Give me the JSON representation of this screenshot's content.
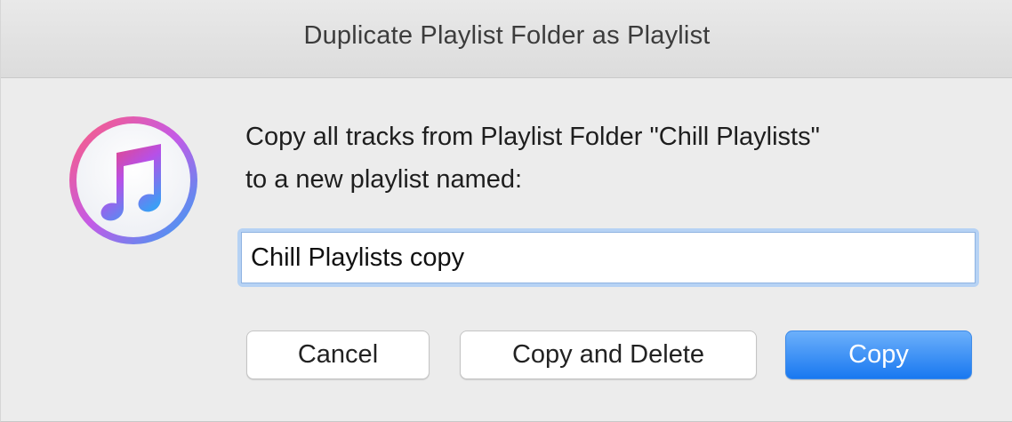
{
  "window": {
    "title": "Duplicate Playlist Folder as Playlist"
  },
  "app_icon": {
    "name": "itunes-icon",
    "colors": {
      "ring_start": "#ff5e7a",
      "ring_end": "#2aa5f5",
      "note_start": "#f2456d",
      "note_mid": "#b650e8",
      "note_end": "#3b9ef5"
    }
  },
  "message": {
    "line1": "Copy all tracks from Playlist Folder \"Chill Playlists\"",
    "line2": "to a new playlist named:"
  },
  "name_field": {
    "value": "Chill Playlists copy"
  },
  "buttons": {
    "cancel": "Cancel",
    "copy_and_delete": "Copy and Delete",
    "copy": "Copy"
  },
  "colors": {
    "accent": "#1978f0",
    "focus_ring": "#b6d2f4"
  }
}
